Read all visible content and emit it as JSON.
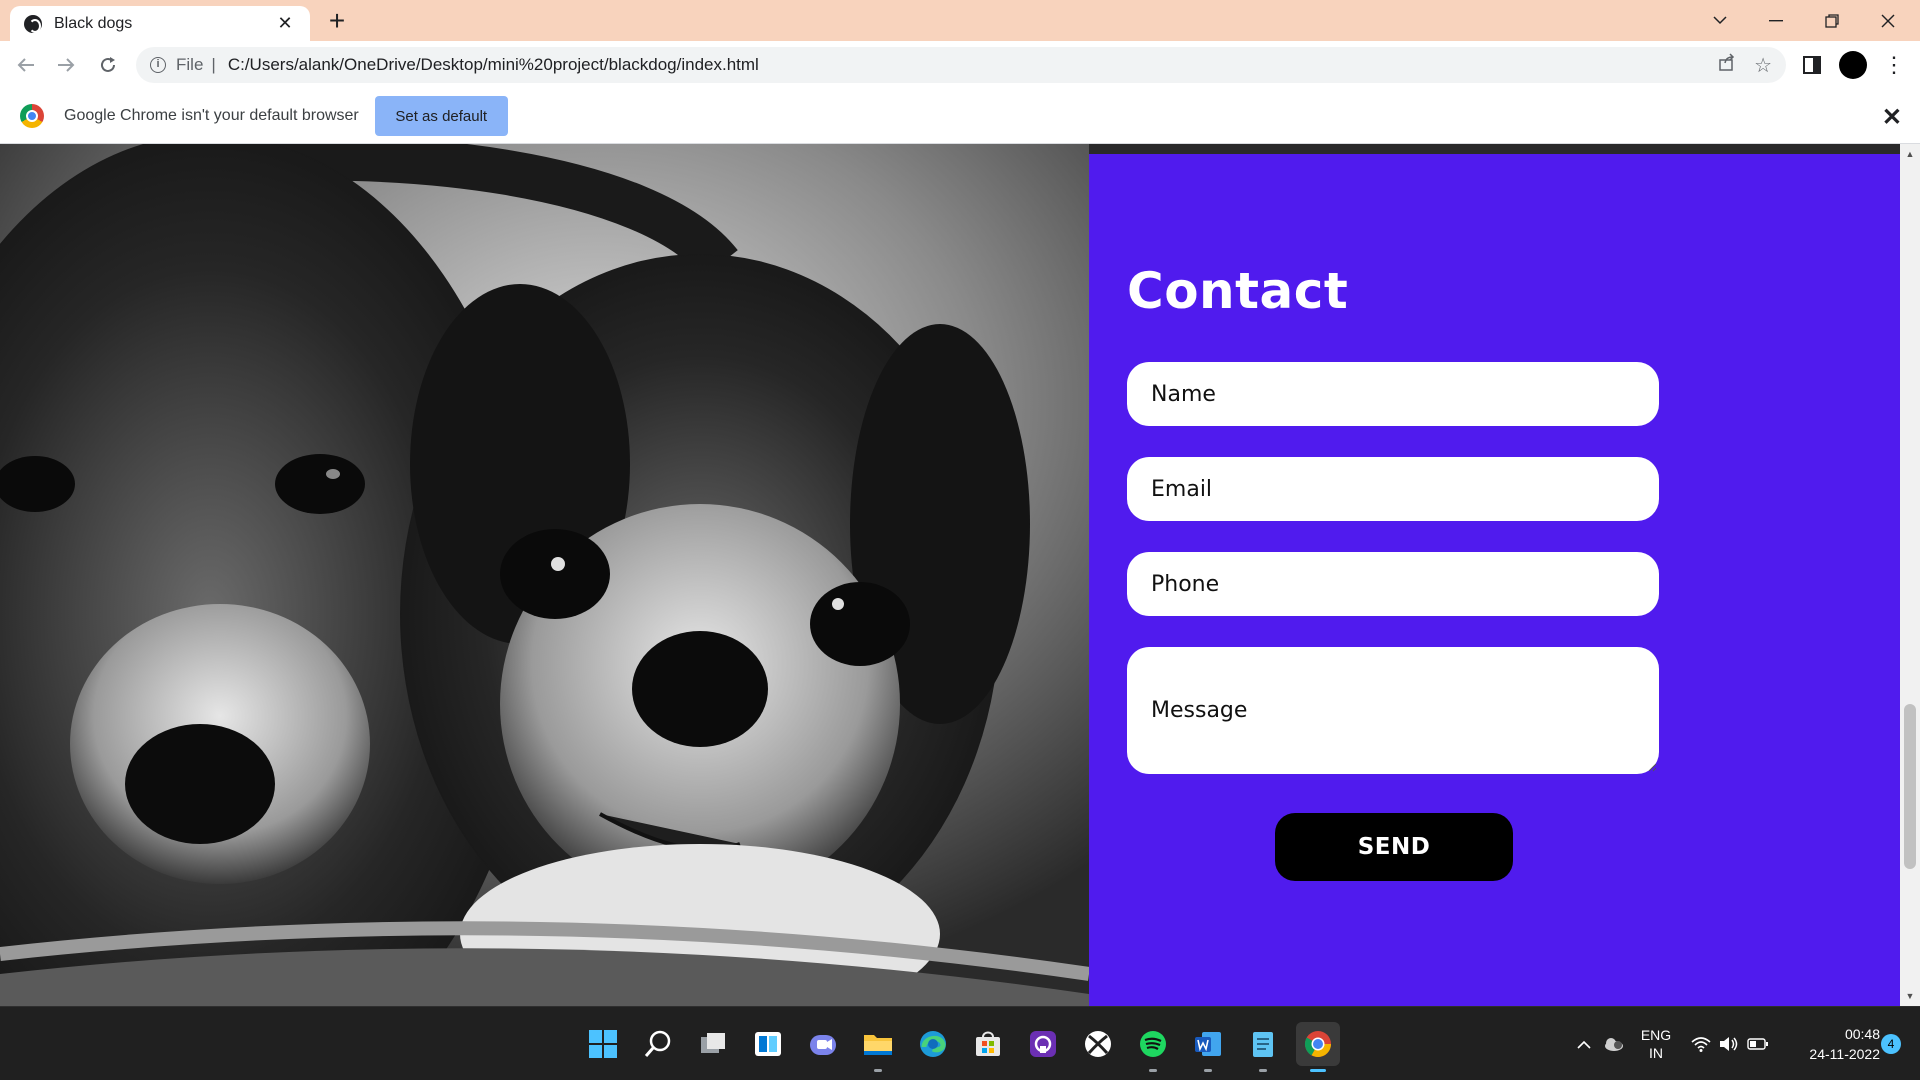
{
  "browser": {
    "tab_title": "Black dogs",
    "new_tab_symbol": "+",
    "address": {
      "scheme_label": "File",
      "separator": "|",
      "url": "C:/Users/alank/OneDrive/Desktop/mini%20project/blackdog/index.html"
    },
    "infobar": {
      "message": "Google Chrome isn't your default browser",
      "button_label": "Set as default"
    }
  },
  "contact": {
    "heading": "Contact",
    "name_placeholder": "Name",
    "email_placeholder": "Email",
    "phone_placeholder": "Phone",
    "message_placeholder": "Message",
    "send_label": "SEND",
    "background_color": "#501bee"
  },
  "taskbar": {
    "apps": [
      "windows-start-icon",
      "search-icon",
      "task-view-icon",
      "widgets-icon",
      "teams-chat-icon",
      "file-explorer-icon",
      "edge-icon",
      "store-icon",
      "app-icon",
      "xbox-icon",
      "spotify-icon",
      "word-icon",
      "notepad-icon",
      "chrome-icon"
    ],
    "language": "ENG",
    "region": "IN",
    "time": "00:48",
    "date": "24-11-2022",
    "notification_count": "4"
  }
}
